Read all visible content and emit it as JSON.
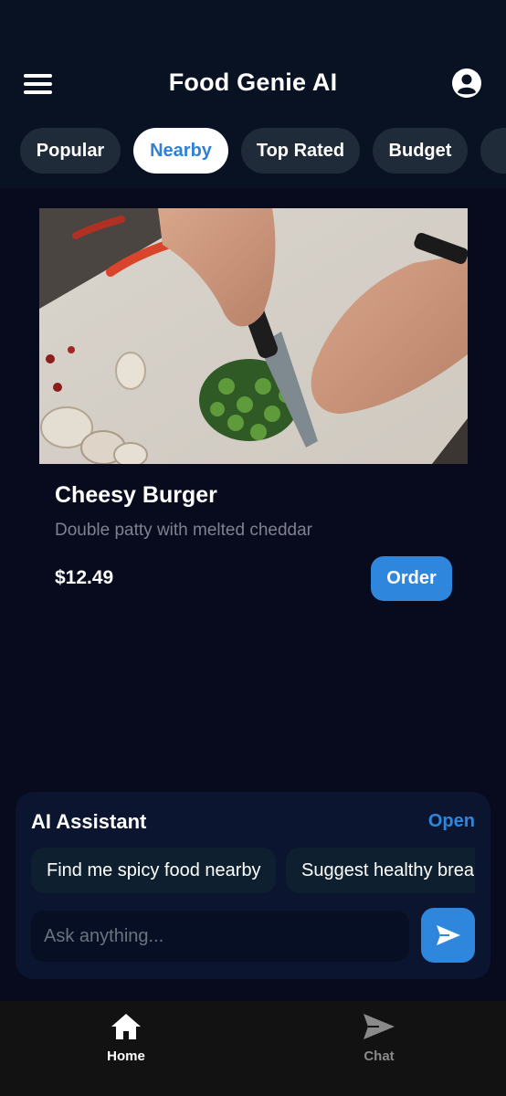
{
  "header": {
    "title": "Food Genie AI",
    "menu_icon": "hamburger-menu-icon",
    "profile_icon": "user-circle-icon"
  },
  "filters": [
    {
      "label": "Popular",
      "active": false
    },
    {
      "label": "Nearby",
      "active": true
    },
    {
      "label": "Top Rated",
      "active": false
    },
    {
      "label": "Budget",
      "active": false
    },
    {
      "label": "",
      "active": false
    }
  ],
  "card": {
    "image": "chopping-vegetables-photo",
    "name": "Cheesy Burger",
    "description": "Double patty with melted cheddar",
    "price": "$12.49",
    "order_label": "Order"
  },
  "assistant": {
    "title": "AI Assistant",
    "open_label": "Open",
    "suggestions": [
      "Find me spicy food nearby",
      "Suggest healthy breal"
    ],
    "input_placeholder": "Ask anything...",
    "send_icon": "send-icon"
  },
  "nav": {
    "items": [
      {
        "label": "Home",
        "icon": "home-icon",
        "active": true
      },
      {
        "label": "Chat",
        "icon": "send-icon",
        "active": false
      }
    ]
  },
  "colors": {
    "background": "#070b1d",
    "header": "#081222",
    "accent": "#2f86dd",
    "chip": "#1f2b38",
    "muted_text": "#7d8190"
  }
}
